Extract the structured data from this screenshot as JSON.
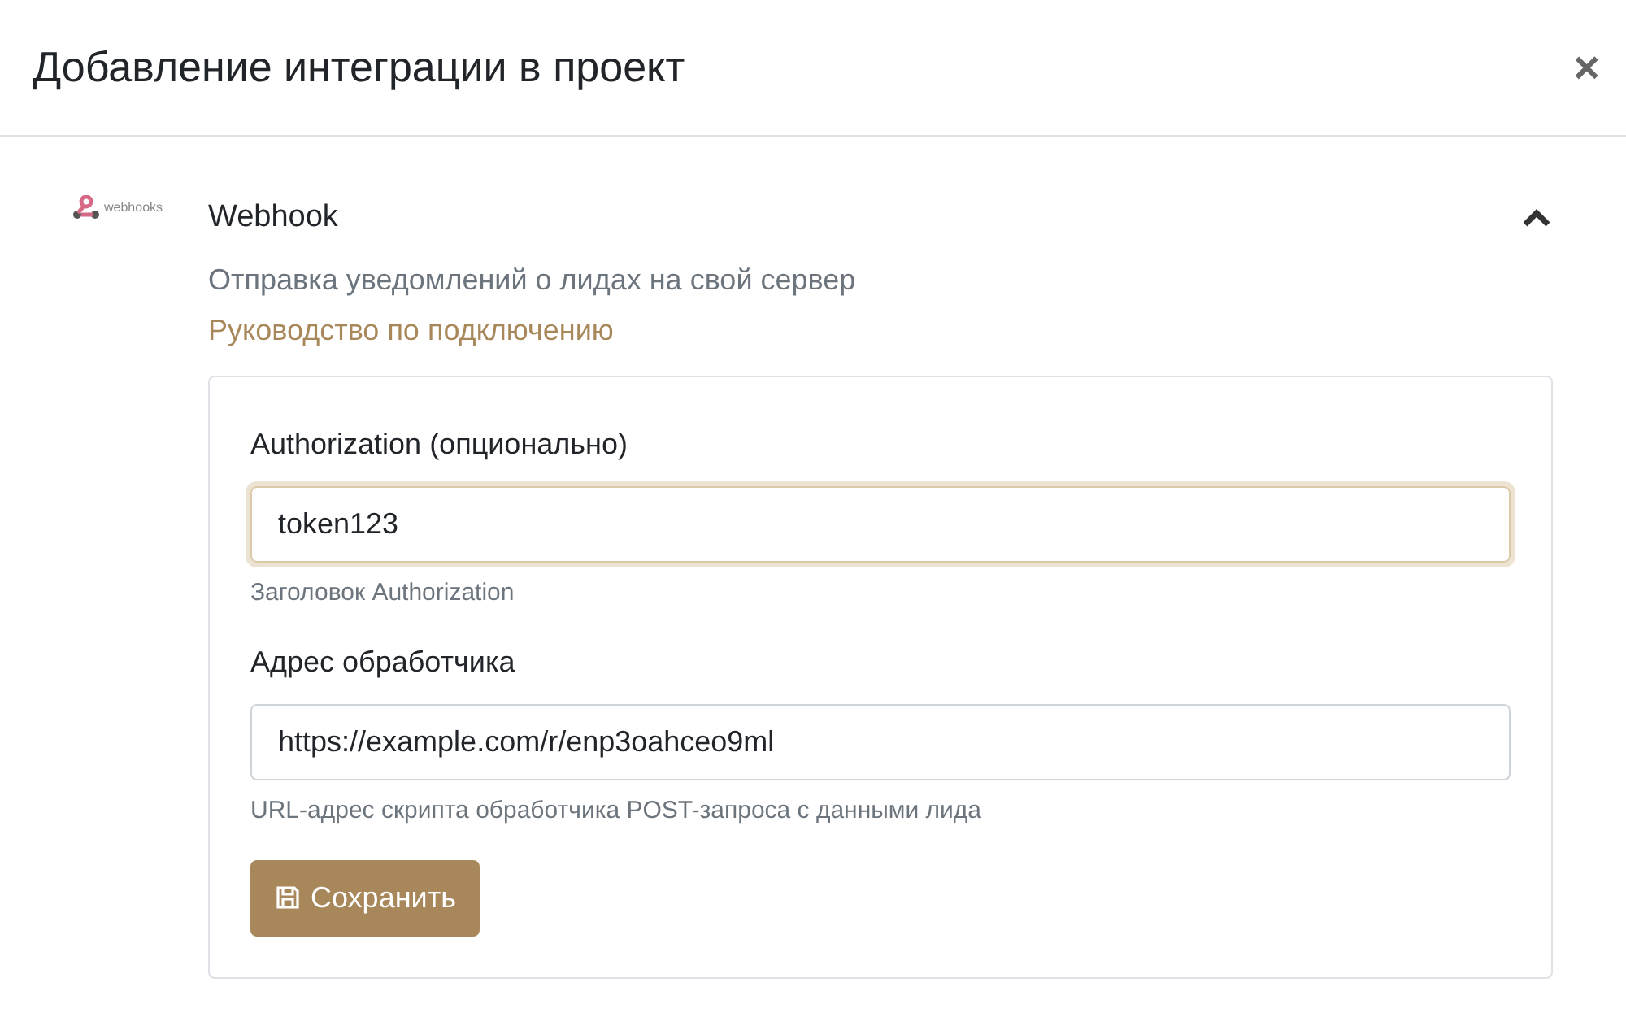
{
  "dialog": {
    "title": "Добавление интеграции в проект",
    "close": "×"
  },
  "integration": {
    "logo_text": "webhooks",
    "name": "Webhook",
    "expanded": true,
    "description": "Отправка уведомлений о лидах на свой сервер",
    "guide_link": "Руководство по подключению",
    "fields": [
      {
        "label": "Authorization (опционально)",
        "value": "token123",
        "focused": true,
        "help": "Заголовок Authorization"
      },
      {
        "label": "Адрес обработчика",
        "value": "https://example.com/r/enp3oahceo9ml",
        "focused": false,
        "help": "URL-адрес скрипта обработчика POST-запроса с данными лида"
      }
    ],
    "save_button": "Сохранить"
  }
}
